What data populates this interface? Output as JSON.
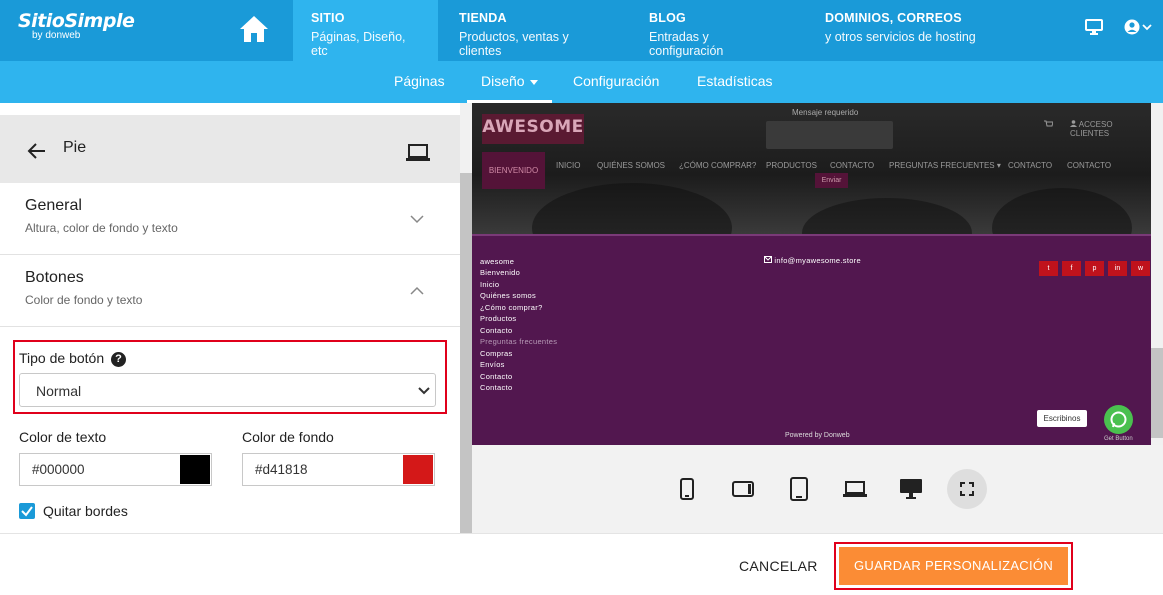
{
  "brand": {
    "name": "SitioSimple",
    "by": "by donweb"
  },
  "top_nav": [
    {
      "title": "SITIO",
      "subtitle": "Páginas, Diseño, etc"
    },
    {
      "title": "TIENDA",
      "subtitle": "Productos, ventas y clientes"
    },
    {
      "title": "BLOG",
      "subtitle": "Entradas y configuración"
    },
    {
      "title": "DOMINIOS, CORREOS",
      "subtitle": "y otros servicios de hosting"
    }
  ],
  "sub_nav": [
    "Páginas",
    "Diseño",
    "Configuración",
    "Estadísticas"
  ],
  "panel": {
    "title": "Pie",
    "sections": [
      {
        "title": "General",
        "subtitle": "Altura, color de fondo y texto"
      },
      {
        "title": "Botones",
        "subtitle": "Color de fondo y texto"
      }
    ],
    "button_type_label": "Tipo de botón",
    "button_type_value": "Normal",
    "text_color_label": "Color de texto",
    "text_color_value": "#000000",
    "bg_color_label": "Color de fondo",
    "bg_color_value": "#d41818",
    "remove_borders_label": "Quitar bordes",
    "remove_borders_checked": true
  },
  "preview": {
    "logo": "AWESOME",
    "message_label": "Mensaje requerido",
    "account": "ACCESO CLIENTES",
    "menu": [
      "BIENVENIDO",
      "INICIO",
      "QUIÉNES SOMOS",
      "¿CÓMO COMPRAR?",
      "PRODUCTOS",
      "CONTACTO",
      "PREGUNTAS FRECUENTES",
      "CONTACTO",
      "CONTACTO"
    ],
    "enviar": "Enviar",
    "footer_links": [
      "awesome",
      "Bienvenido",
      "Inicio",
      "Quiénes somos",
      "¿Cómo comprar?",
      "Productos",
      "Contacto",
      "Preguntas frecuentes",
      "Compras",
      "Envíos",
      "Contacto",
      "Contacto"
    ],
    "email": "info@myawesome.store",
    "social": [
      "t",
      "f",
      "p",
      "in",
      "w"
    ],
    "whatsapp_label": "Escribinos",
    "get_button": "Get Button",
    "powered": "Powered by Donweb"
  },
  "footer_bar": {
    "cancel": "CANCELAR",
    "save": "GUARDAR PERSONALIZACIÓN"
  },
  "colors": {
    "primary": "#1a9ad8",
    "active_nav": "#2fb4ee",
    "save": "#fb8c35",
    "highlight": "#e0001b",
    "site_footer": "#52174f",
    "button_bg": "#d41818"
  }
}
